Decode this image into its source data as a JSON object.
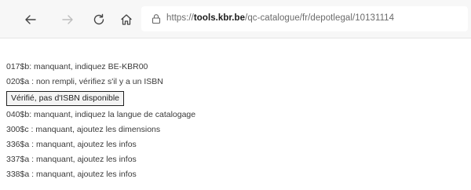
{
  "browser": {
    "url_prefix": "https://",
    "url_domain": "tools.kbr.be",
    "url_path": "/qc-catalogue/fr/depotlegal/10131114"
  },
  "messages": {
    "line1": "017$b: manquant, indiquez BE-KBR00",
    "line2": "020$a : non rempli, vérifiez s'il y a un ISBN",
    "verify_button": "Vérifié, pas d'ISBN disponible",
    "line3": "040$b: manquant, indiquez la langue de catalogage",
    "line4": "300$c : manquant, ajoutez les dimensions",
    "line5": "336$a : manquant, ajoutez les infos",
    "line6": "337$a : manquant, ajoutez les infos",
    "line7": "338$a : manquant, ajoutez les infos"
  }
}
